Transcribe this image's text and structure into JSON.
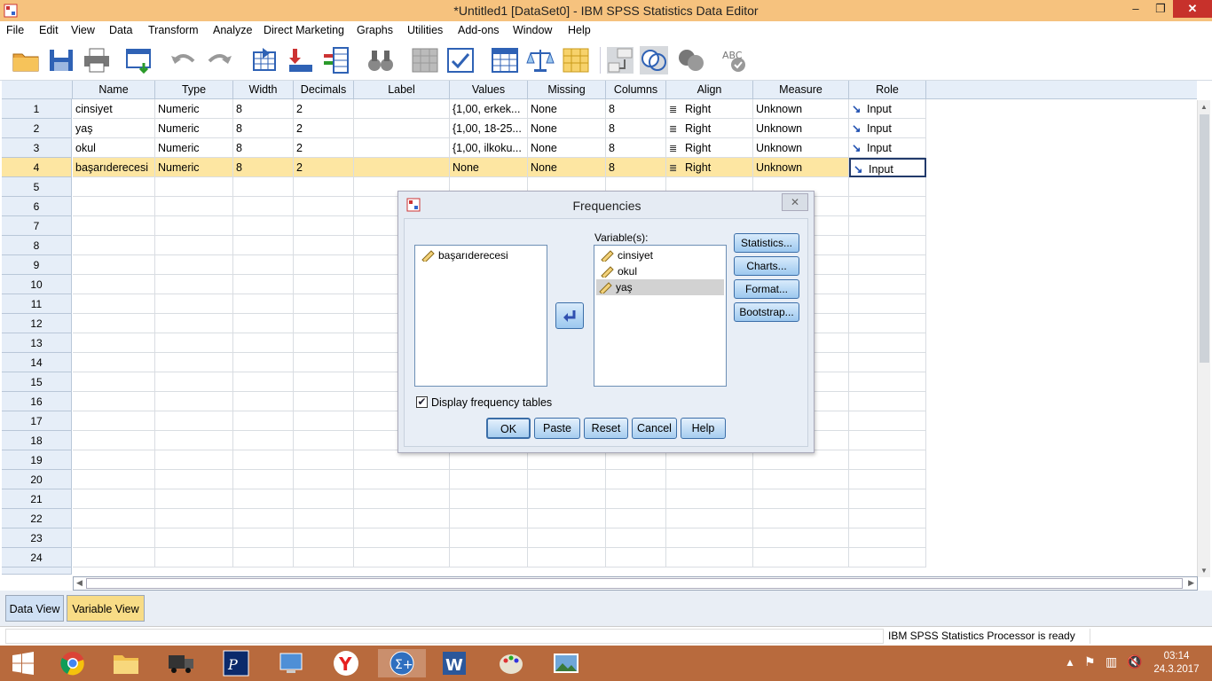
{
  "window": {
    "title": "*Untitled1 [DataSet0] - IBM SPSS Statistics Data Editor",
    "minimize": "‒",
    "restore": "❐",
    "close": "✕"
  },
  "menu": [
    "File",
    "Edit",
    "View",
    "Data",
    "Transform",
    "Analyze",
    "Direct Marketing",
    "Graphs",
    "Utilities",
    "Add-ons",
    "Window",
    "Help"
  ],
  "columns": [
    "Name",
    "Type",
    "Width",
    "Decimals",
    "Label",
    "Values",
    "Missing",
    "Columns",
    "Align",
    "Measure",
    "Role"
  ],
  "rows": [
    {
      "num": "1",
      "name": "cinsiyet",
      "type": "Numeric",
      "width": "8",
      "decimals": "2",
      "label": "",
      "values": "{1,00, erkek...",
      "missing": "None",
      "columns": "8",
      "align": "Right",
      "measure": "Unknown",
      "role": "Input"
    },
    {
      "num": "2",
      "name": "yaş",
      "type": "Numeric",
      "width": "8",
      "decimals": "2",
      "label": "",
      "values": "{1,00, 18-25...",
      "missing": "None",
      "columns": "8",
      "align": "Right",
      "measure": "Unknown",
      "role": "Input"
    },
    {
      "num": "3",
      "name": "okul",
      "type": "Numeric",
      "width": "8",
      "decimals": "2",
      "label": "",
      "values": "{1,00, ilkoku...",
      "missing": "None",
      "columns": "8",
      "align": "Right",
      "measure": "Unknown",
      "role": "Input"
    },
    {
      "num": "4",
      "name": "başarıderecesi",
      "type": "Numeric",
      "width": "8",
      "decimals": "2",
      "label": "",
      "values": "None",
      "missing": "None",
      "columns": "8",
      "align": "Right",
      "measure": "Unknown",
      "role": "Input"
    }
  ],
  "empty_rows": [
    "5",
    "6",
    "7",
    "8",
    "9",
    "10",
    "11",
    "12",
    "13",
    "14",
    "15",
    "16",
    "17",
    "18",
    "19",
    "20",
    "21",
    "22",
    "23",
    "24"
  ],
  "tabs": {
    "data_view": "Data View",
    "variable_view": "Variable View"
  },
  "status": {
    "message": "IBM SPSS Statistics Processor is ready"
  },
  "dialog": {
    "title": "Frequencies",
    "close": "✕",
    "source_list": [
      "başarıderecesi"
    ],
    "variables_label": "Variable(s):",
    "target_list": [
      "cinsiyet",
      "okul",
      "yaş"
    ],
    "side_buttons": [
      "Statistics...",
      "Charts...",
      "Format...",
      "Bootstrap..."
    ],
    "checkbox_label": "Display frequency tables",
    "checkbox_checked": true,
    "bottom_buttons": [
      "OK",
      "Paste",
      "Reset",
      "Cancel",
      "Help"
    ]
  },
  "taskbar": {
    "time": "03:14",
    "date": "24.3.2017",
    "apps": [
      "start-icon",
      "chrome-icon",
      "file-explorer-icon",
      "truck-game-icon",
      "pascal-icon",
      "control-panel-icon",
      "yandex-icon",
      "spss-icon",
      "word-icon",
      "paint-icon",
      "photos-icon"
    ]
  }
}
